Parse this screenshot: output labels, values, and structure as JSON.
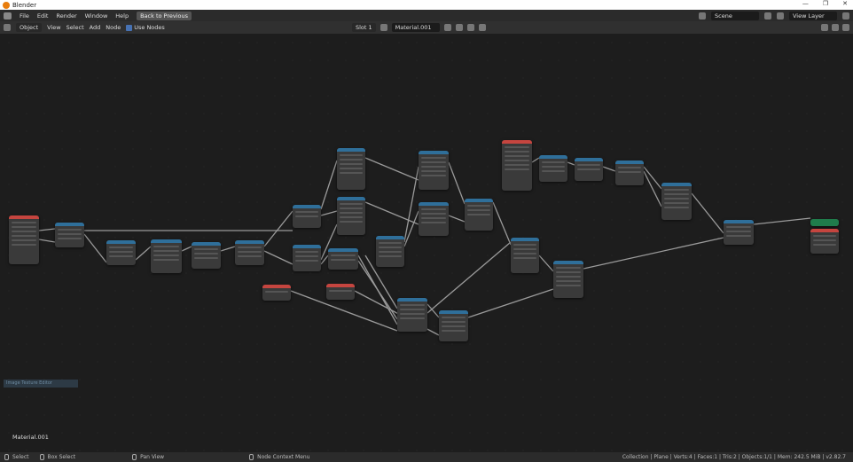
{
  "app": {
    "title": "Blender"
  },
  "menu": {
    "items": [
      "File",
      "Edit",
      "Render",
      "Window",
      "Help"
    ],
    "back_button": "Back to Previous",
    "scene_value": "Scene",
    "view_layer_value": "View Layer"
  },
  "header": {
    "object_mode": "Object",
    "view": "View",
    "select": "Select",
    "add": "Add",
    "node": "Node",
    "use_nodes": "Use Nodes",
    "slot": "Slot 1",
    "material": "Material.001"
  },
  "editor": {
    "material_label": "Material.001",
    "sidebox_text": "Image Texture Editor"
  },
  "status": {
    "select": "Select",
    "box_select": "Box Select",
    "pan_view": "Pan View",
    "node_context_menu": "Node Context Menu",
    "stats": "Collection | Plane | Verts:4 | Faces:1 | Tris:2 | Objects:1/1 | Mem: 242.5 MiB | v2.82.7"
  }
}
